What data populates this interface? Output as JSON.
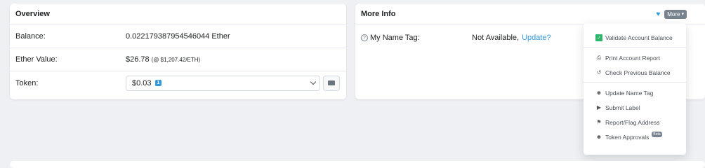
{
  "overview": {
    "title": "Overview",
    "balance_label": "Balance:",
    "balance_value": "0.022179387954546044 Ether",
    "ether_value_label": "Ether Value:",
    "ether_value": "$26.78",
    "ether_price": "(@ $1,207.42/ETH)",
    "token_label": "Token:",
    "token_value": "$0.03",
    "token_count": "1"
  },
  "more_info": {
    "title": "More Info",
    "more_button": "More",
    "name_tag_label": "My Name Tag:",
    "name_tag_value": "Not Available,",
    "name_tag_link": "Update?"
  },
  "menu": {
    "items": [
      {
        "label": "Validate Account Balance",
        "icon": "check-square-icon"
      },
      {
        "label": "Print Account Report",
        "icon": "print-icon"
      },
      {
        "label": "Check Previous Balance",
        "icon": "history-icon"
      },
      {
        "label": "Update Name Tag",
        "icon": "user-edit-icon"
      },
      {
        "label": "Submit Label",
        "icon": "tag-icon"
      },
      {
        "label": "Report/Flag Address",
        "icon": "flag-icon"
      },
      {
        "label": "Token Approvals",
        "icon": "user-check-icon"
      }
    ],
    "beta_badge": "Beta"
  },
  "colors": {
    "accent": "#3498db",
    "check": "#2fb56a",
    "muted": "#77838f"
  }
}
